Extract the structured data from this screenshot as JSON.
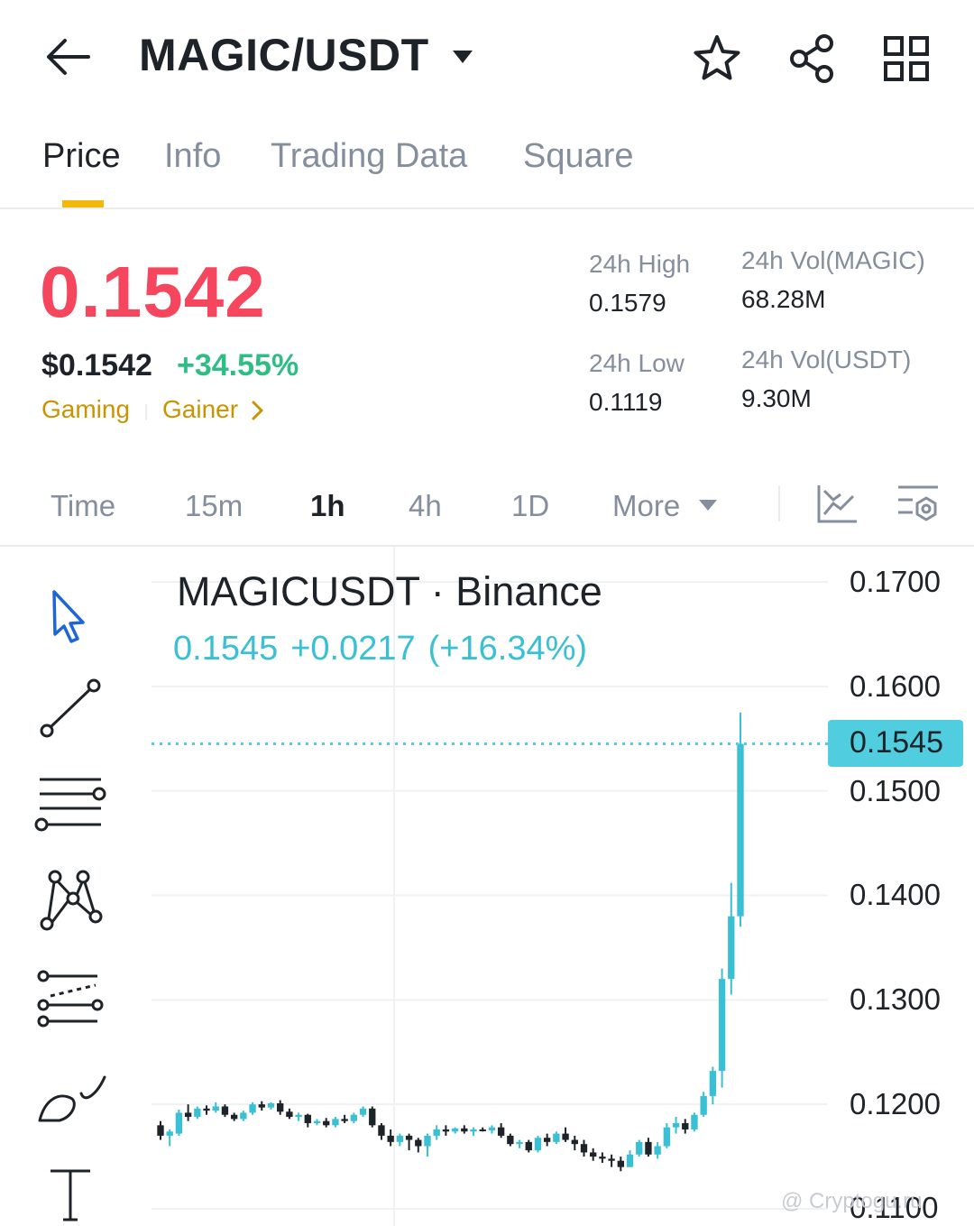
{
  "header": {
    "pair": "MAGIC/USDT",
    "icons": [
      "arrow-left-icon",
      "caret-down-icon",
      "star-icon",
      "share-icon",
      "grid-icon"
    ]
  },
  "tabs": [
    {
      "label": "Price",
      "active": true
    },
    {
      "label": "Info",
      "active": false
    },
    {
      "label": "Trading Data",
      "active": false
    },
    {
      "label": "Square",
      "active": false
    }
  ],
  "price": {
    "last": "0.1542",
    "usd": "$0.1542",
    "change_pct": "+34.55%",
    "tags": [
      "Gaming",
      "Gainer"
    ]
  },
  "stats": {
    "high_label": "24h High",
    "high": "0.1579",
    "low_label": "24h Low",
    "low": "0.1119",
    "vol_base_label": "24h Vol(MAGIC)",
    "vol_base": "68.28M",
    "vol_quote_label": "24h Vol(USDT)",
    "vol_quote": "9.30M"
  },
  "intervals": [
    {
      "label": "Time",
      "active": false
    },
    {
      "label": "15m",
      "active": false
    },
    {
      "label": "1h",
      "active": true
    },
    {
      "label": "4h",
      "active": false
    },
    {
      "label": "1D",
      "active": false
    },
    {
      "label": "More",
      "active": false
    }
  ],
  "drawing_tools": [
    "cursor-icon",
    "trend-line-icon",
    "fib-lines-icon",
    "pattern-icon",
    "channel-icon",
    "brush-icon",
    "text-icon"
  ],
  "chart": {
    "symbol_line": "MAGICUSDT · Binance",
    "quote_price": "0.1545",
    "quote_change": "+0.0217",
    "quote_pct": "(+16.34%)",
    "last_price_tag": "0.1545",
    "y_ticks": [
      "0.1700",
      "0.1600",
      "0.1500",
      "0.1400",
      "0.1300",
      "0.1200",
      "0.1100"
    ],
    "colors": {
      "up": "#39c0d4",
      "down": "#1e2329",
      "last_line": "#51cde0"
    },
    "watermark": "@ Cryptogu.ru"
  },
  "chart_data": {
    "type": "candlestick",
    "interval": "1h",
    "y_range": [
      0.11,
      0.17
    ],
    "last_price": 0.1545,
    "candles": [
      [
        0.118,
        0.1184,
        0.1166,
        0.117
      ],
      [
        0.117,
        0.1176,
        0.116,
        0.1174
      ],
      [
        0.1172,
        0.1195,
        0.117,
        0.1192
      ],
      [
        0.1192,
        0.12,
        0.1184,
        0.1188
      ],
      [
        0.1188,
        0.1198,
        0.1186,
        0.1196
      ],
      [
        0.1196,
        0.1199,
        0.119,
        0.1194
      ],
      [
        0.1194,
        0.1202,
        0.1192,
        0.1198
      ],
      [
        0.1198,
        0.12,
        0.1188,
        0.119
      ],
      [
        0.119,
        0.1192,
        0.1184,
        0.1186
      ],
      [
        0.1186,
        0.1194,
        0.1184,
        0.1192
      ],
      [
        0.1192,
        0.1202,
        0.119,
        0.12
      ],
      [
        0.12,
        0.1203,
        0.1194,
        0.1197
      ],
      [
        0.1197,
        0.1202,
        0.1195,
        0.1201
      ],
      [
        0.1201,
        0.1204,
        0.119,
        0.1193
      ],
      [
        0.1193,
        0.1196,
        0.1186,
        0.1188
      ],
      [
        0.1188,
        0.1192,
        0.1184,
        0.119
      ],
      [
        0.119,
        0.1191,
        0.1178,
        0.1182
      ],
      [
        0.1182,
        0.1186,
        0.118,
        0.1184
      ],
      [
        0.1184,
        0.1187,
        0.1178,
        0.118
      ],
      [
        0.118,
        0.1188,
        0.1178,
        0.1186
      ],
      [
        0.1186,
        0.119,
        0.1182,
        0.1184
      ],
      [
        0.1184,
        0.1192,
        0.1182,
        0.119
      ],
      [
        0.119,
        0.1198,
        0.1188,
        0.1196
      ],
      [
        0.1196,
        0.1198,
        0.1178,
        0.118
      ],
      [
        0.118,
        0.1182,
        0.1166,
        0.117
      ],
      [
        0.117,
        0.1176,
        0.116,
        0.1164
      ],
      [
        0.1164,
        0.1172,
        0.116,
        0.117
      ],
      [
        0.117,
        0.1172,
        0.1156,
        0.1166
      ],
      [
        0.1166,
        0.1168,
        0.1154,
        0.116
      ],
      [
        0.116,
        0.1172,
        0.115,
        0.117
      ],
      [
        0.117,
        0.118,
        0.1166,
        0.1176
      ],
      [
        0.1176,
        0.118,
        0.117,
        0.1174
      ],
      [
        0.1174,
        0.1178,
        0.1172,
        0.1177
      ],
      [
        0.1177,
        0.118,
        0.1172,
        0.1174
      ],
      [
        0.1174,
        0.1178,
        0.117,
        0.1176
      ],
      [
        0.1176,
        0.1178,
        0.1174,
        0.1175
      ],
      [
        0.1175,
        0.118,
        0.1172,
        0.1178
      ],
      [
        0.1178,
        0.1182,
        0.1168,
        0.117
      ],
      [
        0.117,
        0.1172,
        0.116,
        0.1162
      ],
      [
        0.1162,
        0.1166,
        0.1158,
        0.1164
      ],
      [
        0.1164,
        0.1166,
        0.1154,
        0.1156
      ],
      [
        0.1156,
        0.117,
        0.1154,
        0.1168
      ],
      [
        0.1168,
        0.1172,
        0.116,
        0.1164
      ],
      [
        0.1164,
        0.1174,
        0.1162,
        0.1172
      ],
      [
        0.1172,
        0.1178,
        0.1164,
        0.1166
      ],
      [
        0.1166,
        0.117,
        0.1156,
        0.1162
      ],
      [
        0.1162,
        0.1166,
        0.115,
        0.1154
      ],
      [
        0.1154,
        0.1158,
        0.1146,
        0.115
      ],
      [
        0.115,
        0.1154,
        0.1144,
        0.1148
      ],
      [
        0.1148,
        0.1152,
        0.114,
        0.1146
      ],
      [
        0.1146,
        0.115,
        0.1136,
        0.114
      ],
      [
        0.114,
        0.1156,
        0.114,
        0.1152
      ],
      [
        0.1152,
        0.1166,
        0.115,
        0.1164
      ],
      [
        0.1164,
        0.1168,
        0.115,
        0.1152
      ],
      [
        0.1152,
        0.1164,
        0.1148,
        0.116
      ],
      [
        0.116,
        0.1182,
        0.1158,
        0.1178
      ],
      [
        0.1178,
        0.1188,
        0.1172,
        0.1182
      ],
      [
        0.1182,
        0.1186,
        0.1172,
        0.1176
      ],
      [
        0.1176,
        0.1192,
        0.1174,
        0.119
      ],
      [
        0.119,
        0.1212,
        0.1188,
        0.1208
      ],
      [
        0.1208,
        0.1236,
        0.12,
        0.1232
      ],
      [
        0.1232,
        0.133,
        0.1216,
        0.132
      ],
      [
        0.132,
        0.1412,
        0.1305,
        0.138
      ],
      [
        0.138,
        0.1575,
        0.137,
        0.1545
      ]
    ]
  }
}
